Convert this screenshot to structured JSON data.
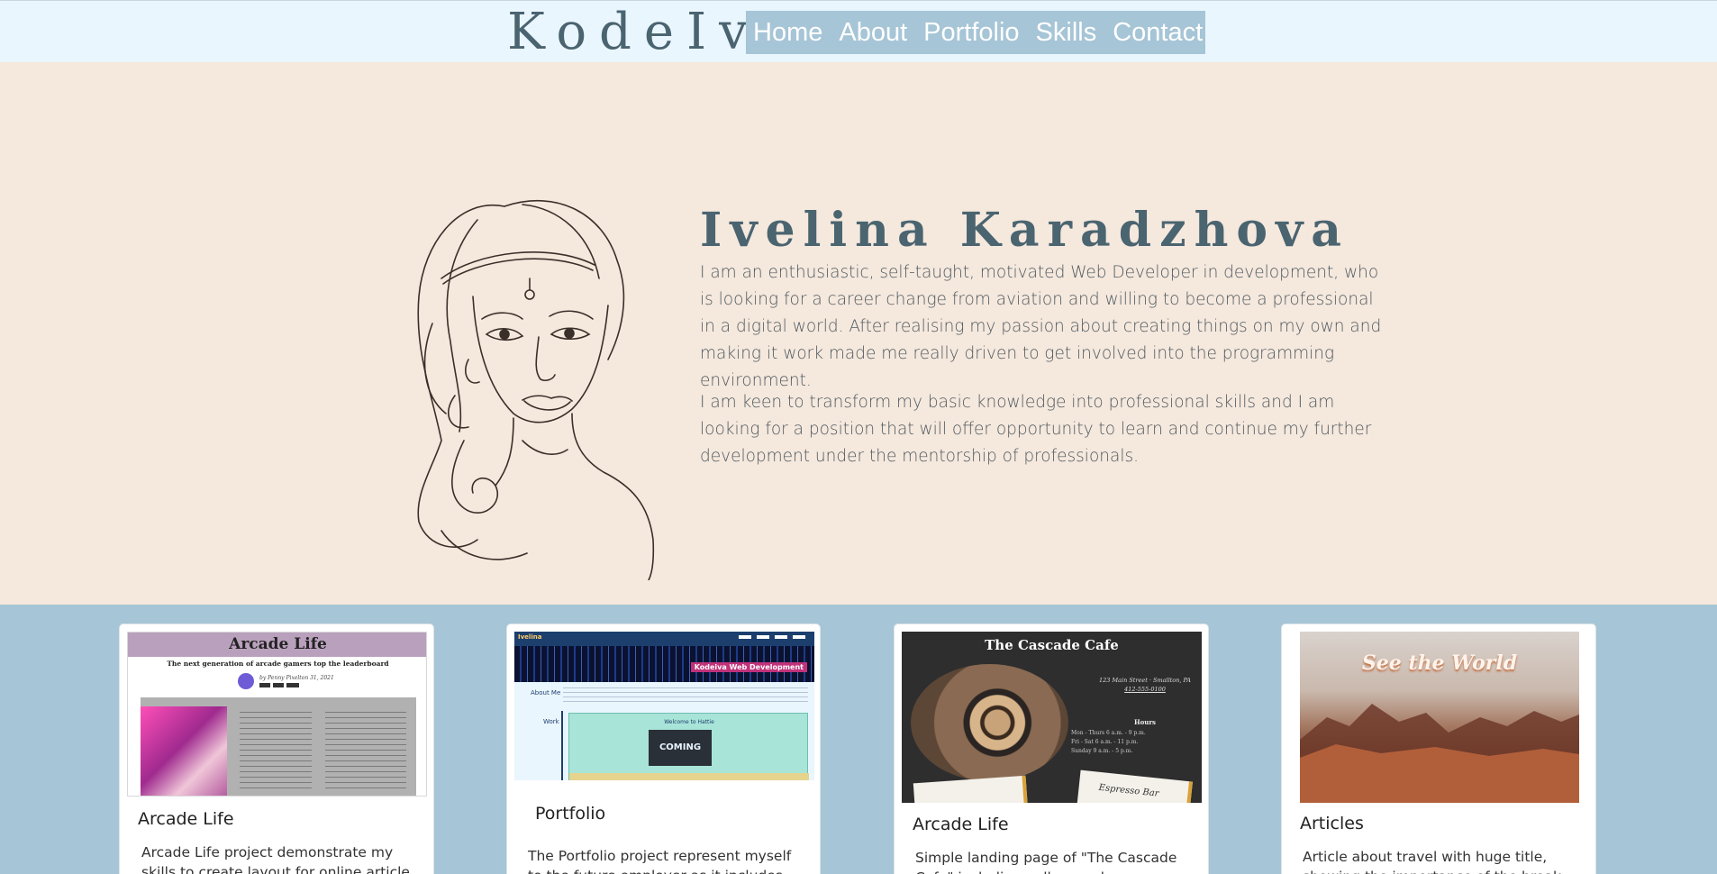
{
  "nav": {
    "brand": "KodeIva",
    "links": [
      "Home",
      "About",
      "Portfolio",
      "Skills",
      "Contact"
    ]
  },
  "hero": {
    "name": "Ivelina Karadzhova",
    "paragraph1": "I am an enthusiastic, self-taught, motivated Web Developer in development, who is looking for a career change from aviation and willing to become a professional in a digital world. After realising my passion about creating things on my own and making it work made me really driven to get involved into the programming environment.",
    "paragraph2": "I am keen to transform my basic knowledge into professional skills and I am looking for a position that will offer opportunity to learn and continue my further development under the mentorship of professionals."
  },
  "cards": [
    {
      "title": "Arcade Life",
      "text": "Arcade Life project demonstrate my skills to create layout for online article.",
      "thumb": {
        "heading": "Arcade Life",
        "subheading": "The next generation of arcade gamers top the leaderboard",
        "byline": "by Penny Pixelton 31, 2021"
      }
    },
    {
      "title": "Portfolio",
      "text": "The Portfolio project represent myself to the future employer as it includes my work.",
      "thumb": {
        "brand": "Ivelina",
        "banner": "Kodeiva Web Development",
        "side1": "About Me",
        "side2": "Work",
        "welcome": "Welcome to Hattie",
        "coming": "COMING SOON!"
      }
    },
    {
      "title": "Arcade Life",
      "text": "Simple landing page of \"The Cascade Cafe\" including gallery and map.",
      "thumb": {
        "heading": "The Cascade Cafe",
        "address1": "123 Main Street · Smallton, PA",
        "address2": "412-555-0100",
        "hours_title": "Hours",
        "hours": [
          "Mon - Thurs   6 a.m. - 9 p.m.",
          "Fri - Sat   6 a.m. - 11 p.m.",
          "Sunday   9 a.m. - 5 p.m."
        ],
        "card_text": "Espresso Bar"
      }
    },
    {
      "title": "Articles",
      "text": "Article about travel with huge title, showing the importance of the break.",
      "thumb": {
        "heading": "See the World"
      }
    }
  ],
  "colors": {
    "navbar_bg": "#eaf6fe",
    "nav_links_bg": "#a6c5d6",
    "hero_bg": "#f5e8dd",
    "section_bg": "#a6c5d6",
    "title_text": "#4a6470"
  }
}
